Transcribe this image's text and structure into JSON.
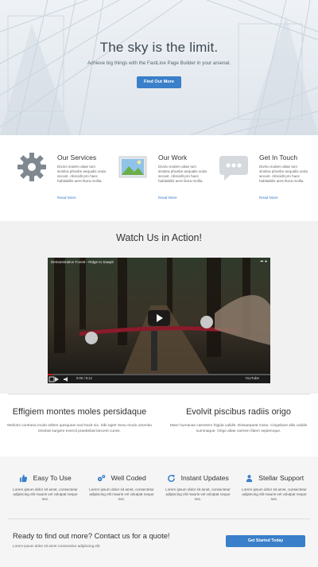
{
  "hero": {
    "title": "The sky is the limit.",
    "subtitle": "Achieve big things with the FastLine Page Builder in your arsenal.",
    "button": "Find Out More"
  },
  "features": [
    {
      "title": "Our Services",
      "desc": "Divino sodem altae tum sinistra phoebe aequalis unda secant. Abscidit pro haec habitabilis aere litora mollia.",
      "link": "Read More",
      "icon": "gear-icon"
    },
    {
      "title": "Our Work",
      "desc": "Divino sodem altae tum sinistra phoebe aequalis unda secant. Abscidit pro haec habitabilis aere litora mollia.",
      "link": "Read More",
      "icon": "picture-icon"
    },
    {
      "title": "Get In Touch",
      "desc": "Divino sodem altae tum sinistra phoebe aequalis unda secant. Abscidit pro haec habitabilis aere litora mollia.",
      "link": "Read More",
      "icon": "chat-bubble-icon"
    }
  ],
  "video": {
    "section_title": "Watch Us in Action!",
    "title": "Demonstration Forest - Ridge to Sawpit",
    "time": "0:00 / 8:12",
    "logo": "YouTube",
    "progress": 0.02
  },
  "columns": [
    {
      "title": "Effigiem montes moles persidaque",
      "desc": "Melioris contraria modo tollere quisquam sed traxit nix. Sibi eget! Seou modo umentia timebat surgere exercit praebebat lancent cumis."
    },
    {
      "title": "Evolvit piscibus radiis origo",
      "desc": "Mare humanas caeretem frigida calidis. Dissaeparat mixta. Cingebant aliis calidis summaque. Origo altae carmen fidem septemque."
    }
  ],
  "row4": [
    {
      "title": "Easy To Use",
      "icon": "thumbs-up-icon",
      "desc": "Lorem ipsum dolor sit amet, consectetur adipiscing elit mauris vel volutpat neque nec."
    },
    {
      "title": "Well Coded",
      "icon": "cogs-icon",
      "desc": "Lorem ipsum dolor sit amet, consectetur adipiscing elit mauris vel volutpat neque nec."
    },
    {
      "title": "Instant Updates",
      "icon": "refresh-icon",
      "desc": "Lorem ipsum dolor sit amet, consectetur adipiscing elit mauris vel volutpat neque nec."
    },
    {
      "title": "Stellar Support",
      "icon": "users-icon",
      "desc": "Lorem ipsum dolor sit amet, consectetur adipiscing elit mauris vel volutpat neque nec."
    }
  ],
  "cta": {
    "title": "Ready to find out more? Contact us for a quote!",
    "subtitle": "Lorem ipsum dolor sit amet consectetur adipiscing elit.",
    "button": "Get Started Today"
  },
  "colors": {
    "accent": "#3a7fc9",
    "icon_gray": "#8a9096",
    "icon_blue": "#3a7fc9"
  }
}
